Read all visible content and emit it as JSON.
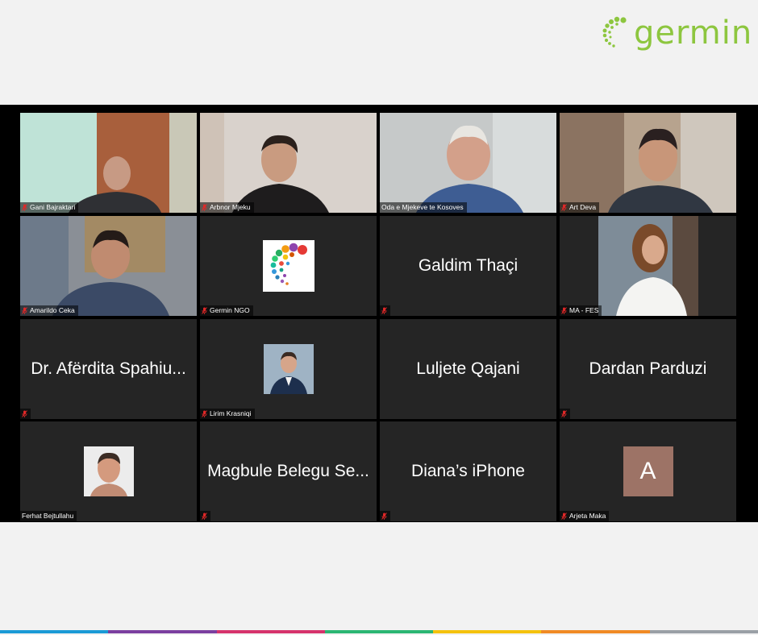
{
  "logo": {
    "text": "germin",
    "color": "#8dc63f"
  },
  "meeting": {
    "active_border_color": "#c7e35a",
    "tiles": [
      {
        "type": "video",
        "label": "Gani Bajraktari"
      },
      {
        "type": "video",
        "label": "Arbnor Mjeku"
      },
      {
        "type": "video",
        "label": "Oda e Mjekeve te Kosoves",
        "active": true
      },
      {
        "type": "video",
        "label": "Art Deva"
      },
      {
        "type": "video",
        "label": "Amarildo Ceka"
      },
      {
        "type": "image",
        "label": "Germin NGO",
        "image": "germin-logo-icon"
      },
      {
        "type": "name",
        "display_name": "Galdim Thaçi",
        "label": ""
      },
      {
        "type": "video",
        "label": "MA - FES"
      },
      {
        "type": "name",
        "display_name": "Dr. Afërdita Spahiu...",
        "label": ""
      },
      {
        "type": "image",
        "label": "Lirim Krasniqi",
        "image": "profile-photo-icon"
      },
      {
        "type": "name",
        "display_name": "Luljete Qajani",
        "label": ""
      },
      {
        "type": "name",
        "display_name": "Dardan Parduzi",
        "label": ""
      },
      {
        "type": "image",
        "label": "Ferhat Bejtullahu",
        "image": "profile-photo-icon"
      },
      {
        "type": "name",
        "display_name": "Magbule Belegu Se...",
        "label": ""
      },
      {
        "type": "name",
        "display_name": "Diana’s iPhone",
        "label": ""
      },
      {
        "type": "avatar",
        "label": "Arjeta Maka",
        "initial": "A",
        "color": "#9d7366"
      }
    ]
  },
  "muted_icon": "microphone-muted-icon",
  "muted_color": "#e02828",
  "footer_colors": [
    "#1a9ad6",
    "#7b3fa0",
    "#d6336c",
    "#2bb673",
    "#f4c20d",
    "#f08a24",
    "#9aa0a6"
  ]
}
